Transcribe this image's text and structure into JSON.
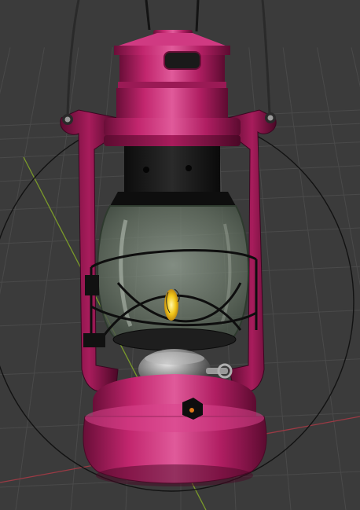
{
  "viewport": {
    "background_color": "#3b3b3b",
    "grid_color": "#4a4a4a",
    "x_axis_color": "#9b3a44",
    "y_axis_color": "#7a9a2a",
    "gizmo_circle_color": "#121212"
  },
  "lantern": {
    "body_color": "#c2266e",
    "body_highlight": "#e05a9a",
    "body_shadow": "#6a0e38",
    "burner_color": "#1a1a1a",
    "globe_color": "#8a9a88",
    "flame_color": "#f2c81a",
    "knob_color": "#9a9a9a"
  }
}
